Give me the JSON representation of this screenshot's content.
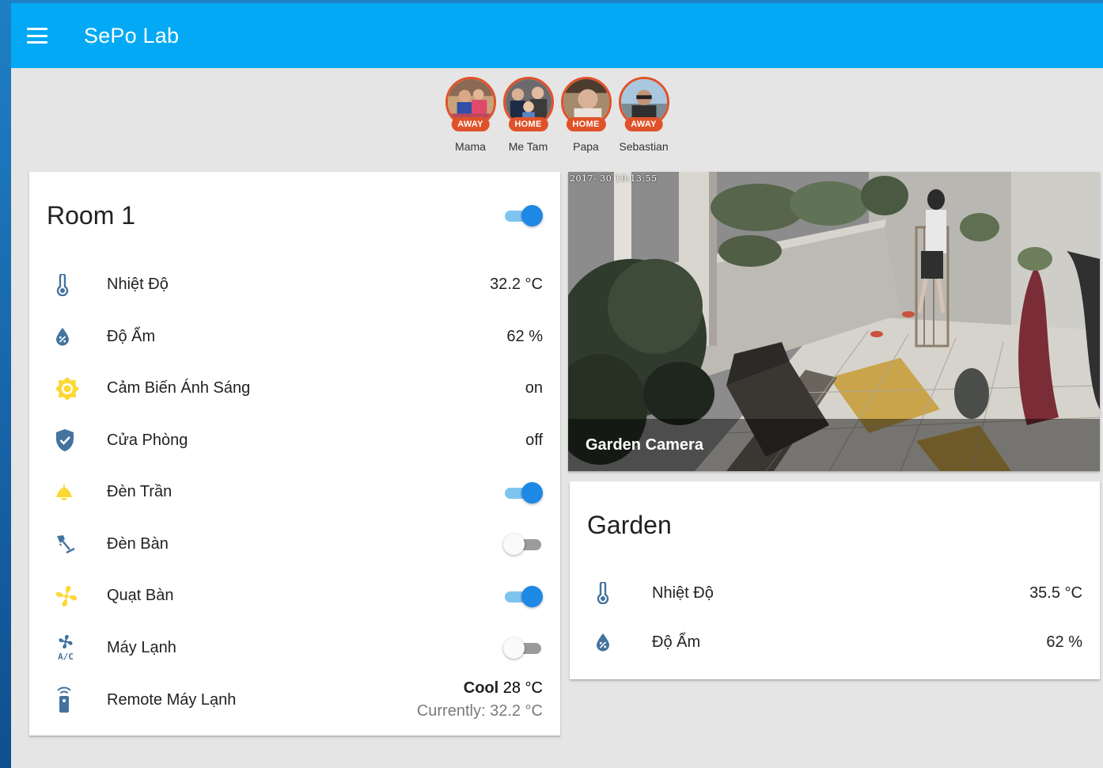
{
  "app": {
    "title": "SePo Lab",
    "menu_icon": "menu-icon"
  },
  "badges": [
    {
      "name": "Mama",
      "state": "AWAY"
    },
    {
      "name": "Me Tam",
      "state": "HOME"
    },
    {
      "name": "Papa",
      "state": "HOME"
    },
    {
      "name": "Sebastian",
      "state": "AWAY"
    }
  ],
  "room1": {
    "title": "Room 1",
    "master_toggle": "on",
    "rows": [
      {
        "icon": "thermometer-icon",
        "label": "Nhiệt Độ",
        "value": "32.2 °C"
      },
      {
        "icon": "water-percent-icon",
        "label": "Độ Ẩm",
        "value": "62 %"
      },
      {
        "icon": "brightness-icon",
        "label": "Cảm Biến Ánh Sáng",
        "value": "on"
      },
      {
        "icon": "shield-check-icon",
        "label": "Cửa Phòng",
        "value": "off"
      },
      {
        "icon": "ceiling-light-icon",
        "label": "Đèn Trần",
        "toggle": "on"
      },
      {
        "icon": "desk-lamp-icon",
        "label": "Đèn Bàn",
        "toggle": "off"
      },
      {
        "icon": "fan-icon",
        "label": "Quạt Bàn",
        "toggle": "on"
      },
      {
        "icon": "air-conditioner-icon",
        "label": "Máy Lạnh",
        "toggle": "off"
      },
      {
        "icon": "remote-icon",
        "label": "Remote Máy Lạnh",
        "mode": "Cool",
        "target": "28 °C",
        "current": "Currently: 32.2 °C"
      }
    ]
  },
  "camera": {
    "title": "Garden Camera",
    "timestamp": "2017- 30 10:13:55"
  },
  "garden": {
    "title": "Garden",
    "rows": [
      {
        "icon": "thermometer-icon",
        "label": "Nhiệt Độ",
        "value": "35.5 °C"
      },
      {
        "icon": "water-percent-icon",
        "label": "Độ Ẩm",
        "value": "62 %"
      }
    ]
  },
  "colors": {
    "toolbar": "#03a9f4",
    "badge": "#e0522a",
    "icon_blue": "#44739e",
    "icon_yellow": "#fdd835",
    "toggle_on": "#1e88e5"
  }
}
